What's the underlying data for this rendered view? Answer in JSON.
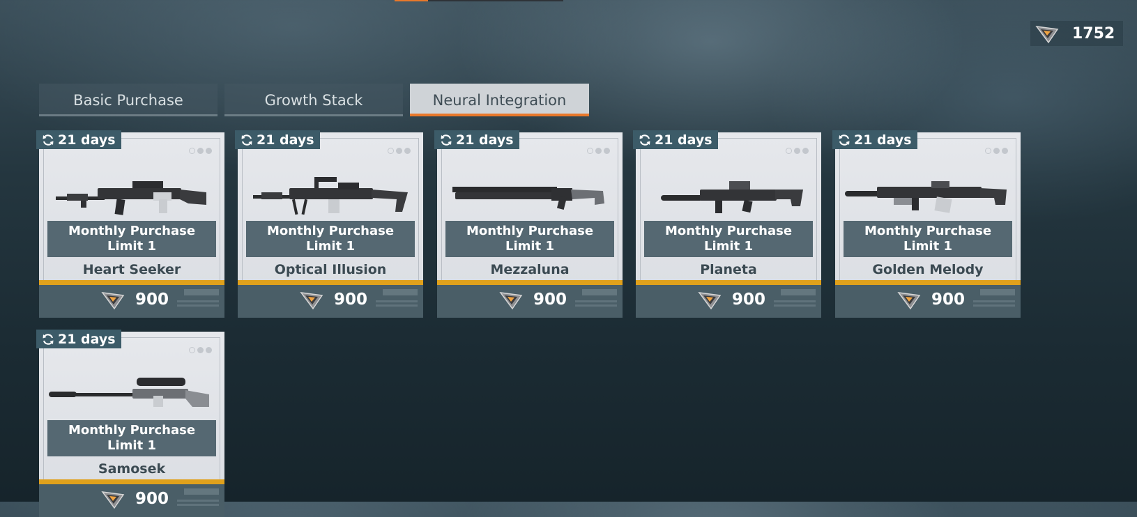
{
  "currency": {
    "icon": "coin-icon",
    "amount": "1752"
  },
  "tabs": [
    {
      "label": "Basic Purchase",
      "active": false
    },
    {
      "label": "Growth Stack",
      "active": false
    },
    {
      "label": "Neural Integration",
      "active": true
    }
  ],
  "items": [
    {
      "name": "Heart Seeker",
      "refresh": "21 days",
      "limit": [
        "Monthly Purchase",
        "Limit 1"
      ],
      "price": "900",
      "icon": "rifle-icon"
    },
    {
      "name": "Optical Illusion",
      "refresh": "21 days",
      "limit": [
        "Monthly Purchase",
        "Limit 1"
      ],
      "price": "900",
      "icon": "machine-gun-icon"
    },
    {
      "name": "Mezzaluna",
      "refresh": "21 days",
      "limit": [
        "Monthly Purchase",
        "Limit 1"
      ],
      "price": "900",
      "icon": "shotgun-icon"
    },
    {
      "name": "Planeta",
      "refresh": "21 days",
      "limit": [
        "Monthly Purchase",
        "Limit 1"
      ],
      "price": "900",
      "icon": "smg-icon"
    },
    {
      "name": "Golden Melody",
      "refresh": "21 days",
      "limit": [
        "Monthly Purchase",
        "Limit 1"
      ],
      "price": "900",
      "icon": "carbine-icon"
    },
    {
      "name": "Samosek",
      "refresh": "21 days",
      "limit": [
        "Monthly Purchase",
        "Limit 1"
      ],
      "price": "900",
      "icon": "sniper-rifle-icon"
    }
  ],
  "colors": {
    "accent": "#e9782a",
    "gold": "#e0a11c",
    "badge": "#3c5b68",
    "limit_bg": "#556872"
  }
}
